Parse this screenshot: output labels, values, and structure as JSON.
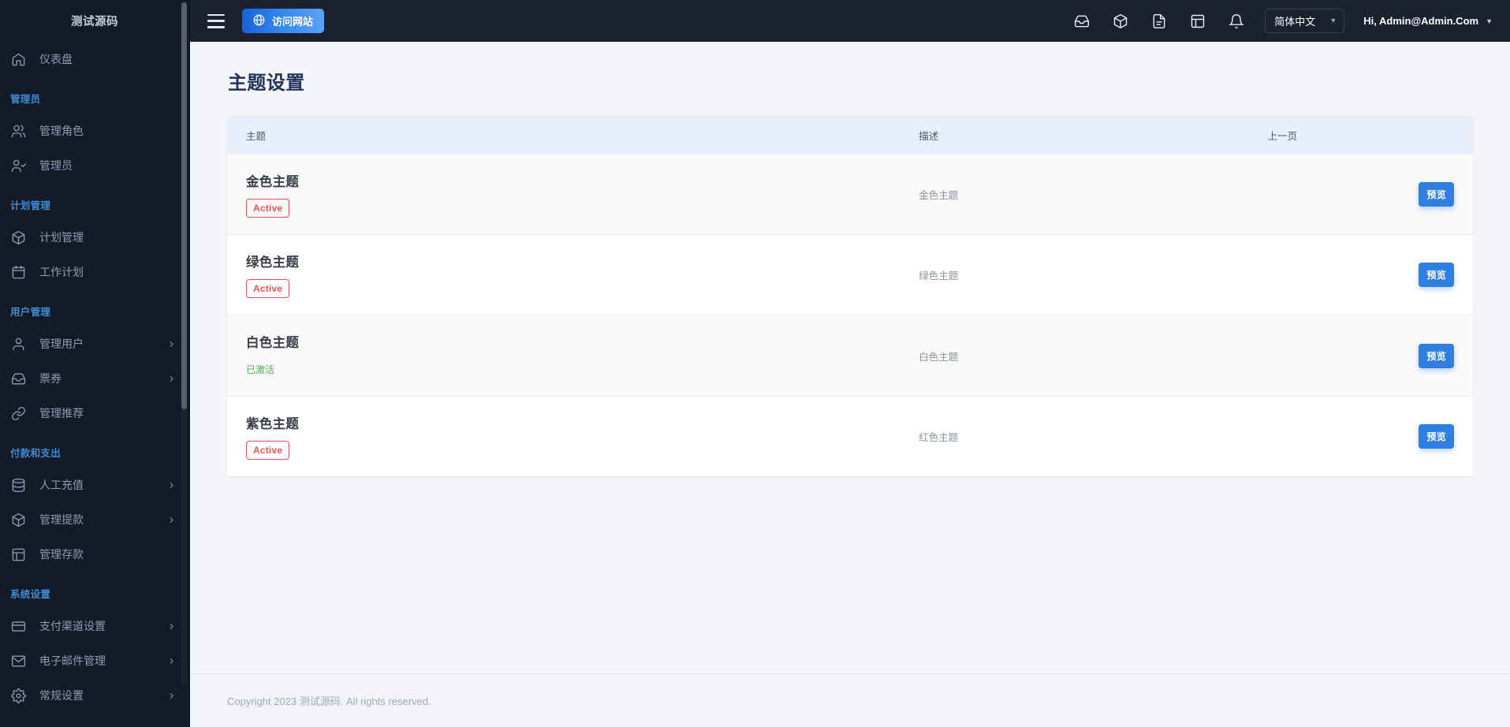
{
  "sidebar": {
    "brand": "测试源码",
    "groups": [
      {
        "label": null,
        "items": [
          {
            "label": "仪表盘",
            "icon": "home-icon",
            "caret": false
          }
        ]
      },
      {
        "label": "管理员",
        "items": [
          {
            "label": "管理角色",
            "icon": "users-icon",
            "caret": false
          },
          {
            "label": "管理员",
            "icon": "user-check-icon",
            "caret": false
          }
        ]
      },
      {
        "label": "计划管理",
        "items": [
          {
            "label": "计划管理",
            "icon": "box-icon",
            "caret": false
          },
          {
            "label": "工作计划",
            "icon": "calendar-icon",
            "caret": false
          }
        ]
      },
      {
        "label": "用户管理",
        "items": [
          {
            "label": "管理用户",
            "icon": "user-icon",
            "caret": true
          },
          {
            "label": "票券",
            "icon": "inbox-icon",
            "caret": true
          },
          {
            "label": "管理推荐",
            "icon": "link-icon",
            "caret": false
          }
        ]
      },
      {
        "label": "付款和支出",
        "items": [
          {
            "label": "人工充值",
            "icon": "database-icon",
            "caret": true
          },
          {
            "label": "管理提款",
            "icon": "box-icon",
            "caret": true
          },
          {
            "label": "管理存款",
            "icon": "table-icon",
            "caret": false
          }
        ]
      },
      {
        "label": "系统设置",
        "items": [
          {
            "label": "支付渠道设置",
            "icon": "credit-card-icon",
            "caret": true
          },
          {
            "label": "电子邮件管理",
            "icon": "mail-icon",
            "caret": true
          },
          {
            "label": "常规设置",
            "icon": "settings-icon",
            "caret": true
          }
        ]
      }
    ]
  },
  "topbar": {
    "visit_site_label": "访问网站",
    "icons": [
      "inbox-icon",
      "package-icon",
      "file-text-icon",
      "layout-table-icon",
      "bell-icon"
    ],
    "language": "简体中文",
    "user_greeting": "Hi, Admin@Admin.Com"
  },
  "main": {
    "page_title": "主题设置",
    "table": {
      "headers": {
        "theme": "主题",
        "description": "描述",
        "action": "上一页"
      },
      "rows": [
        {
          "name": "金色主题",
          "status": "Active",
          "status_style": "badge",
          "description": "金色主题",
          "button": "预览"
        },
        {
          "name": "绿色主题",
          "status": "Active",
          "status_style": "badge",
          "description": "绿色主题",
          "button": "预览"
        },
        {
          "name": "白色主题",
          "status": "已激活",
          "status_style": "plain",
          "description": "白色主题",
          "button": "预览"
        },
        {
          "name": "紫色主题",
          "status": "Active",
          "status_style": "badge",
          "description": "红色主题",
          "button": "预览"
        }
      ]
    }
  },
  "footer": {
    "copyright": "Copyright 2023 测试源码. All rights reserved."
  },
  "colors": {
    "sidebar_bg": "#131b28",
    "topbar_bg": "#1b2130",
    "accent_blue": "#2f7fe0",
    "section_label": "#3f8bd4",
    "title_navy": "#21325b",
    "badge_red": "#ef5350",
    "status_green": "#4caf50",
    "table_header_bg": "#e9eefb"
  }
}
